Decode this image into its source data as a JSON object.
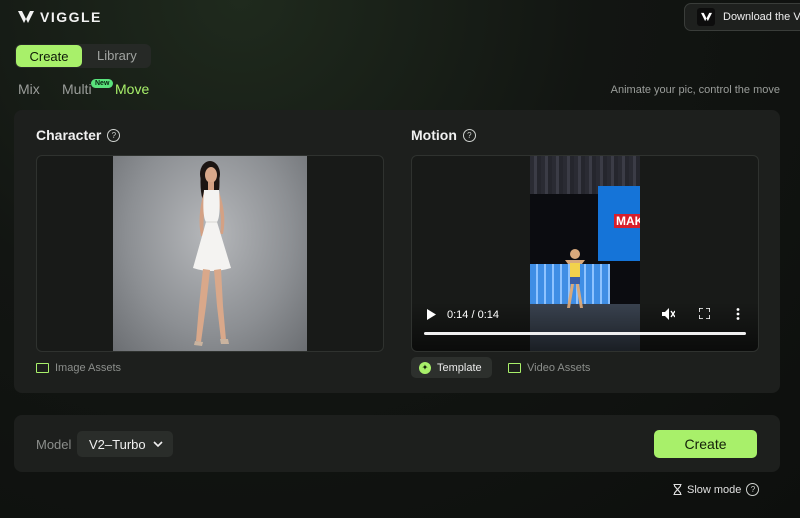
{
  "header": {
    "brand": "VIGGLE",
    "download_label": "Download the V"
  },
  "tabs": {
    "create": "Create",
    "library": "Library"
  },
  "modes": {
    "mix": "Mix",
    "multi": "Multi",
    "multi_badge": "New",
    "move": "Move",
    "active": "Move"
  },
  "tagline": "Animate your pic, control the move",
  "character": {
    "title": "Character",
    "help": "?",
    "assets_label": "Image Assets"
  },
  "motion": {
    "title": "Motion",
    "help": "?",
    "banner_text": "MAKI",
    "video_time": "0:14 / 0:14",
    "progress": 1.0,
    "template_label": "Template",
    "assets_label": "Video Assets"
  },
  "bottom": {
    "model_label": "Model",
    "model_value": "V2–Turbo",
    "create_label": "Create",
    "slow_mode_label": "Slow mode",
    "help": "?"
  },
  "colors": {
    "accent": "#a8f06a",
    "panel": "#1d1f1d",
    "badge": "#59e37c"
  }
}
